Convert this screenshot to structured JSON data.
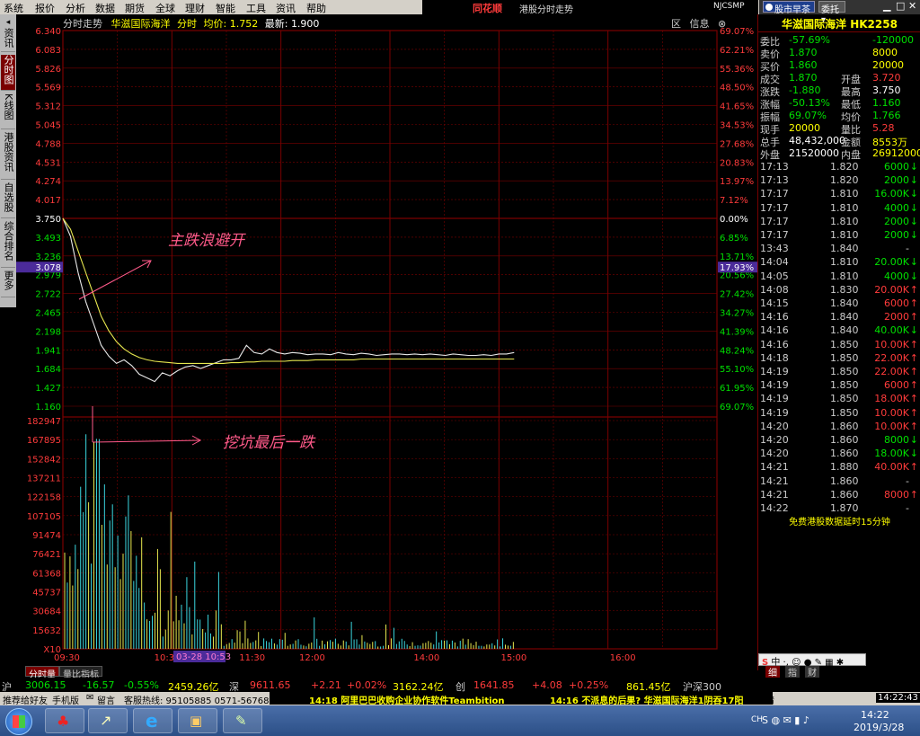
{
  "menu": [
    "系统",
    "报价",
    "分析",
    "数据",
    "期货",
    "全球",
    "理财",
    "智能",
    "工具",
    "资讯",
    "帮助"
  ],
  "brand": "同花顺",
  "window_title": "港股分时走势",
  "account_id": "NJCSMP",
  "top_right": {
    "btn1": "股市早茶",
    "btn2": "委托"
  },
  "left_nav": [
    "资讯",
    "分时图",
    "K线图",
    "港股资讯",
    "自选股",
    "综合排名",
    "更多"
  ],
  "header": {
    "label": "分时走势",
    "stock": "华滋国际海洋",
    "mode": "分时",
    "avg_label": "均价:",
    "avg": "1.752",
    "latest_label": "最新:",
    "latest": "1.900"
  },
  "tools": {
    "close": "区",
    "info": "信息",
    "more": "⊗"
  },
  "price_axis": [
    "6.340",
    "6.083",
    "5.826",
    "5.569",
    "5.312",
    "5.045",
    "4.788",
    "4.531",
    "4.274",
    "4.017",
    "3.750",
    "3.493",
    "3.236",
    "2.979",
    "2.722",
    "2.465",
    "2.198",
    "1.941",
    "1.684",
    "1.427",
    "1.160"
  ],
  "pct_axis": [
    "69.07%",
    "62.21%",
    "55.36%",
    "48.50%",
    "41.65%",
    "34.53%",
    "27.68%",
    "20.83%",
    "13.97%",
    "7.12%",
    "0.00%",
    "6.85%",
    "13.71%",
    "20.56%",
    "27.42%",
    "34.27%",
    "41.39%",
    "48.24%",
    "55.10%",
    "61.95%",
    "69.07%"
  ],
  "cursor": {
    "price": "3.078",
    "pct": "17.93%",
    "date": "03-28 10:53"
  },
  "vol_axis": [
    "182947",
    "167895",
    "152842",
    "137211",
    "122158",
    "107105",
    "91474",
    "76421",
    "61368",
    "45737",
    "30684",
    "15632",
    "X10"
  ],
  "time_axis": [
    "09:30",
    "10:30",
    "11:30",
    "12:00",
    "14:00",
    "15:00",
    "16:00"
  ],
  "annotations": {
    "a1": "主跌浪避开",
    "a2": "挖坑最后一跌"
  },
  "bottom_tabs": [
    "分时量",
    "量比指标"
  ],
  "chart_data": {
    "type": "line",
    "title": "分时走势 华滋国际海洋",
    "ylim": [
      1.16,
      6.34
    ],
    "prev_close": 3.75,
    "series": [
      {
        "name": "分时",
        "values": [
          3.75,
          3.5,
          3.0,
          2.6,
          2.3,
          2.0,
          1.85,
          1.75,
          1.8,
          1.72,
          1.6,
          1.55,
          1.5,
          1.62,
          1.58,
          1.65,
          1.7,
          1.72,
          1.68,
          1.72,
          1.76,
          1.8,
          1.8,
          1.82,
          2.0,
          1.9,
          1.88,
          1.95,
          1.9,
          1.88,
          1.9,
          1.89,
          1.87,
          1.88,
          1.88,
          1.87,
          1.9,
          1.88,
          1.87,
          1.89,
          1.88,
          1.86,
          1.87,
          1.88,
          1.88,
          1.87,
          1.88,
          1.87,
          1.88,
          1.87,
          1.86,
          1.88,
          1.87,
          1.86,
          1.86,
          1.87,
          1.86,
          1.88,
          1.88,
          1.9
        ]
      },
      {
        "name": "均价",
        "values": [
          3.75,
          3.6,
          3.3,
          3.0,
          2.7,
          2.4,
          2.2,
          2.05,
          1.95,
          1.88,
          1.83,
          1.8,
          1.78,
          1.77,
          1.76,
          1.75,
          1.75,
          1.75,
          1.75,
          1.75,
          1.75,
          1.75,
          1.76,
          1.76,
          1.77,
          1.77,
          1.78,
          1.78,
          1.78,
          1.78,
          1.79,
          1.79,
          1.79,
          1.8,
          1.8,
          1.8,
          1.8,
          1.8,
          1.8,
          1.81,
          1.81,
          1.81,
          1.81,
          1.81,
          1.81,
          1.81,
          1.81,
          1.81,
          1.81,
          1.81,
          1.81,
          1.81,
          1.81,
          1.81,
          1.81,
          1.81,
          1.81,
          1.81,
          1.81,
          1.81
        ]
      }
    ],
    "volume_max": 182947
  },
  "quote": {
    "title": "华滋国际海洋 HK2258",
    "rows": [
      [
        "委比",
        "-57.69%",
        "",
        "-120000"
      ],
      [
        "卖价",
        "1.870",
        "",
        "8000"
      ],
      [
        "买价",
        "1.860",
        "",
        "20000"
      ],
      [
        "成交",
        "1.870",
        "开盘",
        "3.720"
      ],
      [
        "涨跌",
        "-1.880",
        "最高",
        "3.750"
      ],
      [
        "涨幅",
        "-50.13%",
        "最低",
        "1.160"
      ],
      [
        "振幅",
        "69.07%",
        "均价",
        "1.766"
      ],
      [
        "现手",
        "20000",
        "量比",
        "5.28"
      ],
      [
        "总手",
        "48,432,000",
        "金额",
        "8553万"
      ],
      [
        "外盘",
        "21520000",
        "内盘",
        "26912000"
      ]
    ],
    "ticks": [
      [
        "17:13",
        "1.820",
        "6000",
        "down"
      ],
      [
        "17:13",
        "1.820",
        "2000",
        "down"
      ],
      [
        "17:17",
        "1.810",
        "16.00K",
        "down"
      ],
      [
        "17:17",
        "1.810",
        "4000",
        "down"
      ],
      [
        "17:17",
        "1.810",
        "2000",
        "down"
      ],
      [
        "17:17",
        "1.810",
        "2000",
        "down"
      ],
      [
        "13:43",
        "1.840",
        "-",
        "none"
      ],
      [
        "14:04",
        "1.810",
        "20.00K",
        "down"
      ],
      [
        "14:05",
        "1.810",
        "4000",
        "down"
      ],
      [
        "14:08",
        "1.830",
        "20.00K",
        "up"
      ],
      [
        "14:15",
        "1.840",
        "6000",
        "up"
      ],
      [
        "14:16",
        "1.840",
        "2000",
        "up"
      ],
      [
        "14:16",
        "1.840",
        "40.00K",
        "down"
      ],
      [
        "14:16",
        "1.850",
        "10.00K",
        "up"
      ],
      [
        "14:18",
        "1.850",
        "22.00K",
        "up"
      ],
      [
        "14:19",
        "1.850",
        "22.00K",
        "up"
      ],
      [
        "14:19",
        "1.850",
        "6000",
        "up"
      ],
      [
        "14:19",
        "1.850",
        "18.00K",
        "up"
      ],
      [
        "14:19",
        "1.850",
        "10.00K",
        "up"
      ],
      [
        "14:20",
        "1.860",
        "10.00K",
        "up"
      ],
      [
        "14:20",
        "1.860",
        "8000",
        "down"
      ],
      [
        "14:20",
        "1.860",
        "18.00K",
        "down"
      ],
      [
        "14:21",
        "1.880",
        "40.00K",
        "up"
      ],
      [
        "14:21",
        "1.860",
        "-",
        "none"
      ],
      [
        "14:21",
        "1.860",
        "8000",
        "up"
      ],
      [
        "14:22",
        "1.870",
        "-",
        "none"
      ]
    ],
    "footer": "免费港股数据延时15分钟",
    "tabs": [
      "细",
      "指",
      "财"
    ]
  },
  "index_line": {
    "a_label": "沪",
    "a_val": "3006.15",
    "a_chg": "-16.57",
    "a_pct": "-0.55%",
    "a_amt": "2459.26亿",
    "b_label": "深",
    "b_val": "9611.65",
    "b_chg": "+2.21",
    "b_pct": "+0.02%",
    "b_amt": "3162.24亿",
    "c_label": "创",
    "c_val": "1641.85",
    "c_chg": "+4.08",
    "c_pct": "+0.25%",
    "c_amt": "861.45亿",
    "d_label": "沪深300"
  },
  "news_line": {
    "recommend": "推荐给好友",
    "mobile": "手机版",
    "message": "留言",
    "hotline": "客服热线: 95105885 0571-56768888",
    "news1": "14:18 阿里巴巴收购企业协作软件Teambition",
    "news2": "14:16 不派息的后果? 华滋国际海洋1阴吞17阳",
    "status": "行情",
    "time": "14:22:43"
  },
  "taskbar": {
    "time": "14:22",
    "date": "2019/3/28",
    "lang": "CH"
  },
  "colors": {
    "up": "#ff3b3b",
    "down": "#00e000",
    "grid": "#7a0000",
    "yellow": "#ffff00",
    "price_line": "#e8e8e8",
    "avg_line": "#e8e84f"
  }
}
